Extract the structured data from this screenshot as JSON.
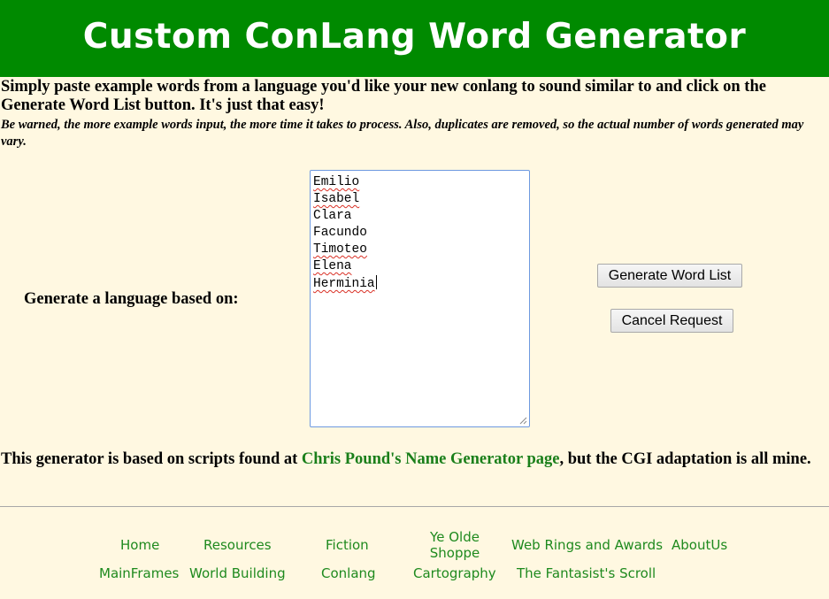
{
  "header": {
    "title": "Custom ConLang Word Generator"
  },
  "intro": {
    "text": "Simply paste example words from a language you'd like your new conlang to sound similar to and click on the Generate Word List button. It's just that easy!",
    "warning": "Be warned, the more example words input, the more time it takes to process. Also, duplicates are removed, so the actual number of words generated may vary."
  },
  "form": {
    "label": "Generate a language based on:",
    "words": [
      {
        "text": "Emilio",
        "misspelled": true
      },
      {
        "text": "Isabel",
        "misspelled": true
      },
      {
        "text": "Clara",
        "misspelled": false
      },
      {
        "text": "Facundo",
        "misspelled": false
      },
      {
        "text": "Timoteo",
        "misspelled": true
      },
      {
        "text": "Elena",
        "misspelled": true
      },
      {
        "text": "Herminia",
        "misspelled": true
      }
    ],
    "generate_button": "Generate Word List",
    "cancel_button": "Cancel Request"
  },
  "credit": {
    "before": "This generator is based on scripts found at ",
    "link": "Chris Pound's Name Generator page",
    "after": ", but the CGI adaptation is all mine."
  },
  "nav": {
    "home": "Home",
    "resources": "Resources",
    "fiction": "Fiction",
    "ye_olde_shoppe": "Ye Olde Shoppe",
    "web_rings": "Web Rings and Awards",
    "about_us": "AboutUs",
    "mainframes": "MainFrames",
    "world_building": "World Building",
    "conlang": "Conlang",
    "cartography": "Cartography",
    "fantasists_scroll": "The Fantasist's Scroll"
  },
  "colors": {
    "header_bg": "#008a00",
    "page_bg": "#fff8e1",
    "link": "#1e8a1e",
    "spellcheck": "#d93025"
  }
}
